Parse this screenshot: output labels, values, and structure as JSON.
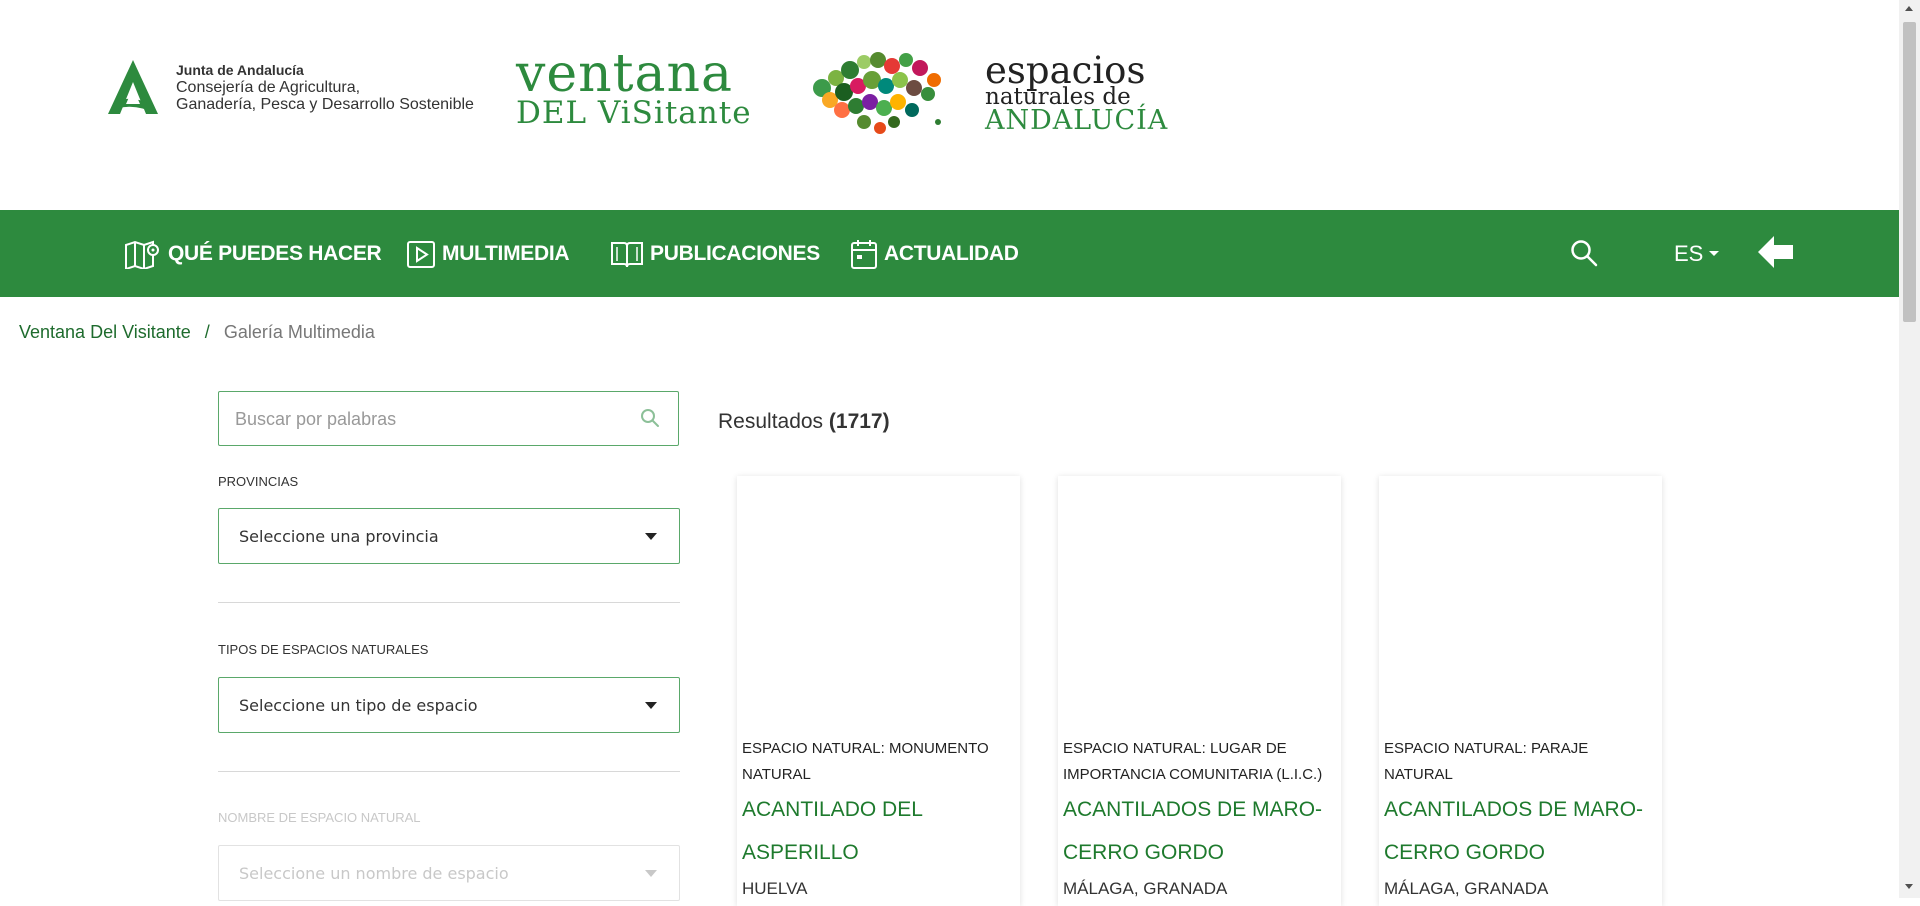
{
  "header": {
    "junta_line1": "Junta de Andalucía",
    "junta_line2": "Consejería de Agricultura,",
    "junta_line3": "Ganadería, Pesca y Desarrollo Sostenible",
    "vv_line1": "ventana",
    "vv_line2": "DEL ViSitante",
    "enat_line1": "espacios",
    "enat_line2": "naturales de",
    "enat_line3": "ANDALUCÍA"
  },
  "nav": {
    "items": [
      {
        "label": "QUÉ PUEDES HACER",
        "icon": "map-pin-icon"
      },
      {
        "label": "MULTIMEDIA",
        "icon": "play-icon"
      },
      {
        "label": "PUBLICACIONES",
        "icon": "book-icon"
      },
      {
        "label": "ACTUALIDAD",
        "icon": "calendar-icon"
      }
    ],
    "language": "ES"
  },
  "breadcrumb": {
    "home": "Ventana Del Visitante",
    "separator": "/",
    "current": "Galería Multimedia"
  },
  "filters": {
    "search_placeholder": "Buscar por palabras",
    "provincias_label": "PROVINCIAS",
    "provincias_value": "Seleccione una provincia",
    "tipos_label": "TIPOS DE ESPACIOS NATURALES",
    "tipos_value": "Seleccione un tipo de espacio",
    "nombre_label": "NOMBRE DE ESPACIO NATURAL",
    "nombre_value": "Seleccione un nombre de espacio"
  },
  "results": {
    "label": "Resultados",
    "count": "(1717)",
    "cards": [
      {
        "type": "ESPACIO NATURAL: MONUMENTO NATURAL",
        "title": "ACANTILADO DEL ASPERILLO",
        "location": "HUELVA"
      },
      {
        "type": "ESPACIO NATURAL: LUGAR DE IMPORTANCIA COMUNITARIA (L.I.C.)",
        "title": "ACANTILADOS DE MARO-CERRO GORDO",
        "location": "MÁLAGA, GRANADA"
      },
      {
        "type": "ESPACIO NATURAL: PARAJE NATURAL",
        "title": "ACANTILADOS DE MARO-CERRO GORDO",
        "location": "MÁLAGA, GRANADA"
      }
    ]
  },
  "colors": {
    "brand_green": "#2d8a3e",
    "link_green": "#1e7a2d"
  }
}
